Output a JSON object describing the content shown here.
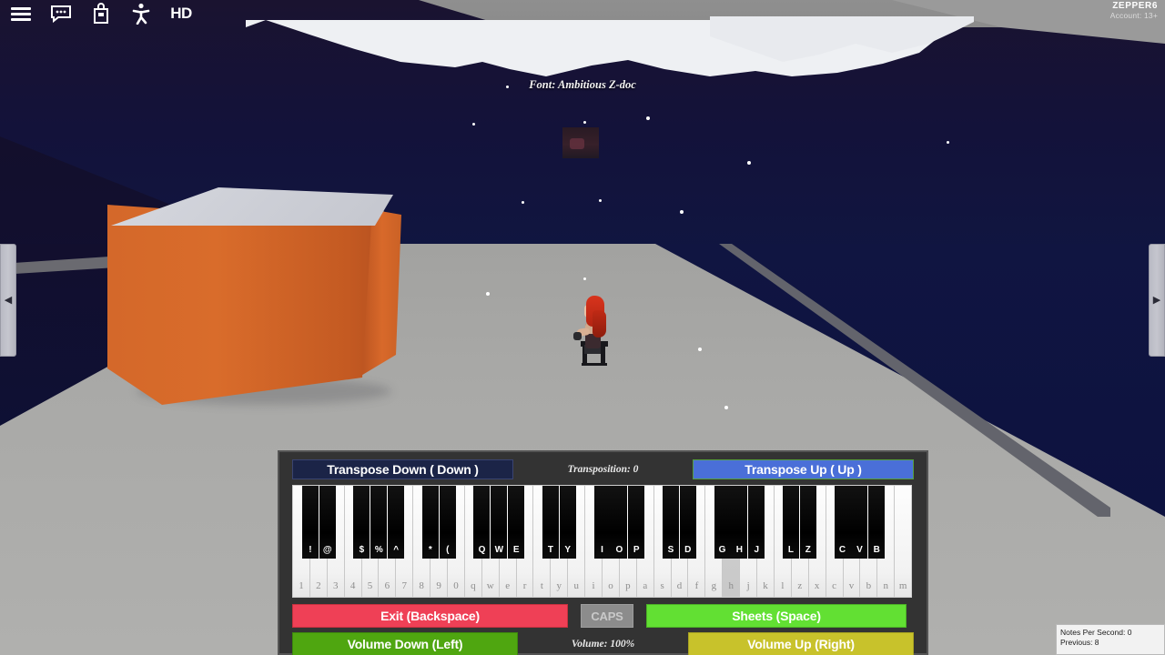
{
  "topbar": {
    "icons": [
      {
        "name": "menu-icon",
        "label": "☰"
      },
      {
        "name": "chat-icon",
        "label": "chat"
      },
      {
        "name": "backpack-icon",
        "label": "backpack"
      },
      {
        "name": "accessibility-icon",
        "label": "accessibility"
      },
      {
        "name": "hd-icon",
        "label": "HD"
      }
    ],
    "account": {
      "username": "ZEPPER6",
      "age_rating": "Account: 13+"
    }
  },
  "side_nav": {
    "left_arrow": "◀",
    "right_arrow": "▶"
  },
  "scene": {
    "font_label": "Font: Ambitious Z-doc"
  },
  "piano": {
    "transpose_down": "Transpose Down ( Down  )",
    "transposition": "Transposition: 0",
    "transpose_up": "Transpose Up (  Up  )",
    "exit": "Exit (Backspace)",
    "caps": "CAPS",
    "sheets": "Sheets (Space)",
    "volume_down": "Volume Down (Left)",
    "volume_text": "Volume: 100%",
    "volume_up": "Volume Up (Right)",
    "white_keys": [
      "1",
      "2",
      "3",
      "4",
      "5",
      "6",
      "7",
      "8",
      "9",
      "0",
      "q",
      "w",
      "e",
      "r",
      "t",
      "y",
      "u",
      "i",
      "o",
      "p",
      "a",
      "s",
      "d",
      "f",
      "g",
      "h",
      "j",
      "k",
      "l",
      "z",
      "x",
      "c",
      "v",
      "b",
      "n",
      "m"
    ],
    "active_white_key": "h",
    "black_keys": [
      {
        "label": "!",
        "after": 0
      },
      {
        "label": "@",
        "after": 1
      },
      {
        "label": "$",
        "after": 3
      },
      {
        "label": "%",
        "after": 4
      },
      {
        "label": "^",
        "after": 5
      },
      {
        "label": "*",
        "after": 7
      },
      {
        "label": "(",
        "after": 8
      },
      {
        "label": "Q",
        "after": 10
      },
      {
        "label": "W",
        "after": 11
      },
      {
        "label": "E",
        "after": 12
      },
      {
        "label": "T",
        "after": 14
      },
      {
        "label": "Y",
        "after": 15
      },
      {
        "label": "I",
        "after": 17
      },
      {
        "label": "O",
        "after": 18
      },
      {
        "label": "P",
        "after": 19
      },
      {
        "label": "S",
        "after": 21
      },
      {
        "label": "D",
        "after": 22
      },
      {
        "label": "G",
        "after": 24
      },
      {
        "label": "H",
        "after": 25
      },
      {
        "label": "J",
        "after": 26
      },
      {
        "label": "L",
        "after": 28
      },
      {
        "label": "Z",
        "after": 29
      },
      {
        "label": "C",
        "after": 31
      },
      {
        "label": "V",
        "after": 32
      },
      {
        "label": "B",
        "after": 33
      }
    ]
  },
  "stats": {
    "notes_per_second": "Notes Per Second: 0",
    "previous": "Previous: 8"
  },
  "colors": {
    "transpose_up": "#4a6fd8",
    "exit": "#ef4056",
    "sheets": "#62e033",
    "volume_down": "#4fa610",
    "volume_up": "#c8c22b",
    "panel": "#333333"
  }
}
